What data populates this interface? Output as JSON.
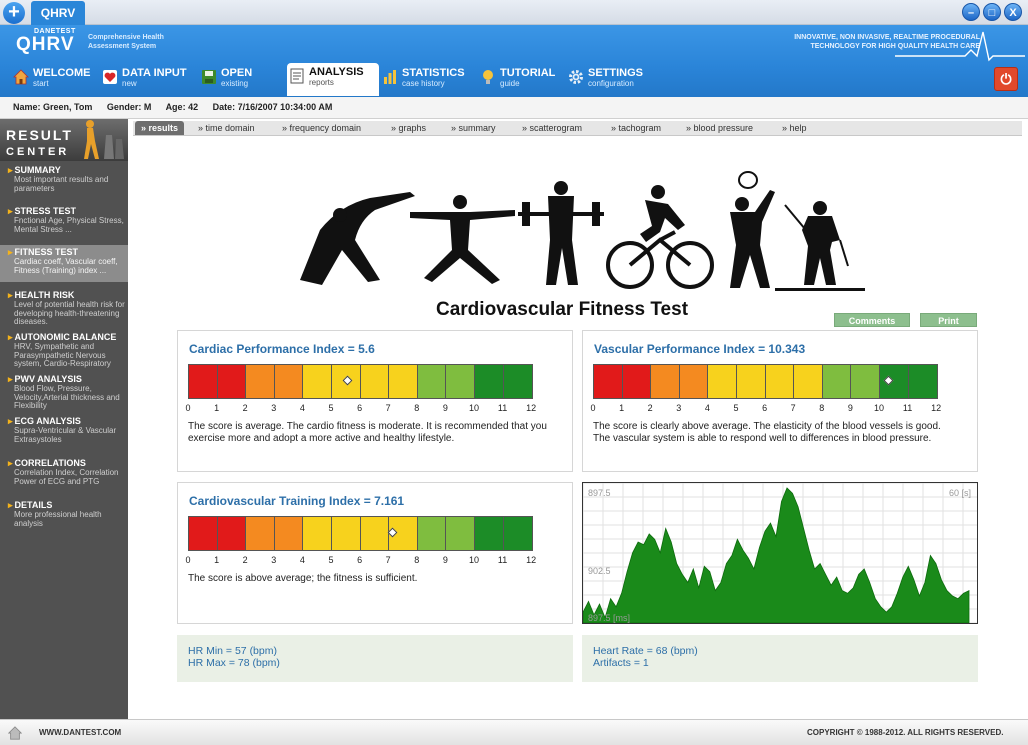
{
  "window": {
    "tab_label": "QHRV",
    "plus": "+",
    "min": "–",
    "max": "□",
    "close": "X"
  },
  "branding": {
    "company": "DANETEST",
    "logo": "QHRV",
    "logo_sub": "Comprehensive Health Assessment System",
    "tagline_1": "INNOVATIVE, NON INVASIVE, REALTIME PROCEDURAL",
    "tagline_2": "TECHNOLOGY FOR HIGH QUALITY HEALTH CARE"
  },
  "nav": [
    {
      "title": "WELCOME",
      "sub": "start",
      "icon": "home-icon"
    },
    {
      "title": "DATA INPUT",
      "sub": "new",
      "icon": "heart-icon"
    },
    {
      "title": "OPEN",
      "sub": "existing",
      "icon": "disk-icon"
    },
    {
      "title": "ANALYSIS",
      "sub": "reports",
      "icon": "document-icon"
    },
    {
      "title": "STATISTICS",
      "sub": "case history",
      "icon": "bar-chart-icon"
    },
    {
      "title": "TUTORIAL",
      "sub": "guide",
      "icon": "lightbulb-icon"
    },
    {
      "title": "SETTINGS",
      "sub": "configuration",
      "icon": "gear-icon"
    }
  ],
  "power_icon": "power-icon",
  "patient": {
    "name": "Name: Green, Tom",
    "gender": "Gender: M",
    "age": "Age: 42",
    "date": "Date: 7/16/2007 10:34:00 AM"
  },
  "sidebar": {
    "title1": "RESULT",
    "title2": "CENTER",
    "items": [
      {
        "title": "SUMMARY",
        "desc": "Most important results and parameters"
      },
      {
        "title": "STRESS TEST",
        "desc": "Fnctional Age, Physical Stress, Mental Stress ..."
      },
      {
        "title": "FITNESS TEST",
        "desc": "Cardiac coeff, Vascular coeff, Fitness (Training) index ..."
      },
      {
        "title": "HEALTH RISK",
        "desc": "Level of potential health risk for developing health-threatening diseases."
      },
      {
        "title": "AUTONOMIC BALANCE",
        "desc": "HRV, Sympathetic and Parasympathetic Nervous system, Cardio-Respiratory"
      },
      {
        "title": "PWV ANALYSIS",
        "desc": "Blood Flow, Pressure, Velocity,Arterial thickness and Flexibility"
      },
      {
        "title": "ECG ANALYSIS",
        "desc": "Supra-Ventricular & Vascular Extrasystoles"
      },
      {
        "title": "CORRELATIONS",
        "desc": "Correlation Index, Correlation Power of ECG and PTG"
      },
      {
        "title": "DETAILS",
        "desc": "More professional health analysis"
      }
    ]
  },
  "subtabs": [
    "» results",
    "» time domain",
    "» frequency domain",
    "» graphs",
    "» summary",
    "» scatterogram",
    "» tachogram",
    "» blood pressure",
    "» help"
  ],
  "main": {
    "title": "Cardiovascular Fitness Test",
    "comments_btn": "Comments",
    "print_btn": "Print"
  },
  "scale": {
    "ticks": [
      "0",
      "1",
      "2",
      "3",
      "4",
      "5",
      "6",
      "7",
      "8",
      "9",
      "10",
      "11",
      "12"
    ],
    "colors": [
      "#e11a1a",
      "#e11a1a",
      "#f48a20",
      "#f48a20",
      "#f7d21d",
      "#f7d21d",
      "#f7d21d",
      "#f7d21d",
      "#7fbd3f",
      "#7fbd3f",
      "#1c8c27",
      "#1c8c27"
    ]
  },
  "panels": {
    "cardiac": {
      "title": "Cardiac Performance Index = 5.6",
      "value": 5.6,
      "desc": "The score is average. The cardio fitness is moderate. It is recommended that you exercise more and adopt a more active and healthy lifestyle."
    },
    "vascular": {
      "title": "Vascular Performance Index = 10.343",
      "value": 10.343,
      "desc": "The score is clearly above average. The elasticity of the blood vessels is good. The vascular system is able to respond well to differences in blood pressure."
    },
    "training": {
      "title": "Cardiovascular Training Index = 7.161",
      "value": 7.161,
      "desc": "The score is above average; the fitness is sufficient."
    }
  },
  "tachogram": {
    "label_top": "897.5",
    "label_mid": "902.5",
    "label_bottom": "897.5 [ms]",
    "label_time": "60 [s]"
  },
  "chart_data": {
    "type": "area",
    "title": "",
    "xlabel": "",
    "ylabel": "",
    "x_range": [
      0,
      60
    ],
    "ylim": [
      0,
      100
    ],
    "color": "#1a8a1a",
    "values": [
      8,
      16,
      6,
      14,
      4,
      18,
      12,
      22,
      38,
      52,
      60,
      58,
      66,
      62,
      52,
      70,
      60,
      44,
      36,
      30,
      40,
      26,
      42,
      38,
      24,
      30,
      44,
      50,
      62,
      54,
      48,
      40,
      56,
      68,
      74,
      64,
      90,
      100,
      96,
      86,
      70,
      54,
      40,
      44,
      36,
      28,
      34,
      24,
      22,
      26,
      36,
      40,
      30,
      18,
      12,
      8,
      12,
      22,
      34,
      42,
      32,
      20,
      30,
      50,
      44,
      32,
      24,
      20,
      18,
      22,
      24
    ]
  },
  "info": {
    "hr_min": "HR Min = 57 (bpm)",
    "hr_max": "HR Max = 78 (bpm)",
    "heart_rate": "Heart Rate = 68 (bpm)",
    "artifacts": "Artifacts = 1"
  },
  "footer": {
    "website": "WWW.DANTEST.COM",
    "copyright": "COPYRIGHT © 1988-2012. ALL RIGHTS RESERVED."
  }
}
